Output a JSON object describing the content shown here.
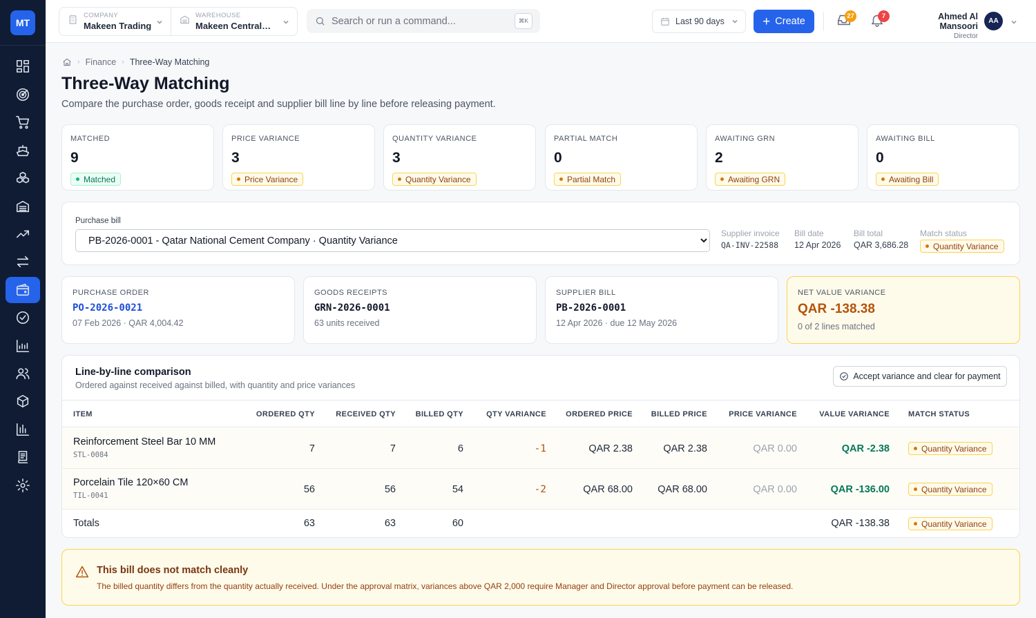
{
  "app": {
    "logo": "MT"
  },
  "sidebar": {
    "items": [
      {
        "icon": "dashboard-icon"
      },
      {
        "icon": "target-icon"
      },
      {
        "icon": "cart-icon"
      },
      {
        "icon": "ship-icon"
      },
      {
        "icon": "boxes-icon"
      },
      {
        "icon": "warehouse-icon"
      },
      {
        "icon": "trending-up-icon"
      },
      {
        "icon": "transfer-icon"
      },
      {
        "icon": "wallet-icon",
        "active": true
      },
      {
        "icon": "check-circle-icon"
      },
      {
        "icon": "chart-icon"
      },
      {
        "icon": "users-icon"
      },
      {
        "icon": "package-icon"
      },
      {
        "icon": "bar-chart-icon"
      },
      {
        "icon": "ledger-icon"
      },
      {
        "icon": "settings-icon"
      }
    ]
  },
  "topbar": {
    "company_label": "COMPANY",
    "company_value": "Makeen Trading",
    "warehouse_label": "WAREHOUSE",
    "warehouse_value": "Makeen Central Warehouse",
    "search_placeholder": "Search or run a command...",
    "search_kbd": "⌘K",
    "date_range": "Last 90 days",
    "create_label": "Create",
    "inbox_count": "27",
    "notif_count": "7",
    "user_name": "Ahmed Al Mansoori",
    "user_role": "Director",
    "user_initials": "AA",
    "colors": {
      "accent": "#2563eb",
      "inbox_badge": "#f59e0b",
      "notif_badge": "#ef4444"
    }
  },
  "breadcrumb": {
    "section": "Finance",
    "current": "Three-Way Matching"
  },
  "page": {
    "title": "Three-Way Matching",
    "subtitle": "Compare the purchase order, goods receipt and supplier bill line by line before releasing payment."
  },
  "stats": [
    {
      "label": "MATCHED",
      "value": "9",
      "pill": "Matched"
    },
    {
      "label": "PRICE VARIANCE",
      "value": "3",
      "pill": "Price Variance"
    },
    {
      "label": "QUANTITY VARIANCE",
      "value": "3",
      "pill": "Quantity Variance"
    },
    {
      "label": "PARTIAL MATCH",
      "value": "0",
      "pill": "Partial Match"
    },
    {
      "label": "AWAITING GRN",
      "value": "2",
      "pill": "Awaiting GRN"
    },
    {
      "label": "AWAITING BILL",
      "value": "0",
      "pill": "Awaiting Bill"
    }
  ],
  "bill": {
    "label": "Purchase bill",
    "selected": "PB-2026-0001 - Qatar National Cement Company · Quantity Variance",
    "supplier_invoice_label": "Supplier invoice",
    "supplier_invoice": "QA-INV-22588",
    "bill_date_label": "Bill date",
    "bill_date": "12 Apr 2026",
    "bill_total_label": "Bill total",
    "bill_total": "QAR 3,686.28",
    "match_status_label": "Match status",
    "match_status": "Quantity Variance"
  },
  "docs": {
    "po_label": "PURCHASE ORDER",
    "po_value": "PO-2026-0021",
    "po_sub": "07 Feb 2026 · QAR 4,004.42",
    "grn_label": "GOODS RECEIPTS",
    "grn_value": "GRN-2026-0001",
    "grn_sub": "63 units received",
    "sb_label": "SUPPLIER BILL",
    "sb_value": "PB-2026-0001",
    "sb_sub": "12 Apr 2026 · due 12 May 2026",
    "nv_label": "NET VALUE VARIANCE",
    "nv_value": "QAR -138.38",
    "nv_sub": "0 of 2 lines matched"
  },
  "table": {
    "title": "Line-by-line comparison",
    "subtitle": "Ordered against received against billed, with quantity and price variances",
    "accept_label": "Accept variance and clear for payment",
    "headers": {
      "item": "ITEM",
      "ordered_qty": "ORDERED QTY",
      "received_qty": "RECEIVED QTY",
      "billed_qty": "BILLED QTY",
      "qty_variance": "QTY VARIANCE",
      "ordered_price": "ORDERED PRICE",
      "billed_price": "BILLED PRICE",
      "price_variance": "PRICE VARIANCE",
      "value_variance": "VALUE VARIANCE",
      "match_status": "MATCH STATUS"
    },
    "rows": [
      {
        "name": "Reinforcement Steel Bar 10 MM",
        "sku": "STL-0084",
        "ordered_qty": "7",
        "received_qty": "7",
        "billed_qty": "6",
        "qty_variance": "-1",
        "ordered_price": "QAR 2.38",
        "billed_price": "QAR 2.38",
        "price_variance": "QAR 0.00",
        "value_variance": "QAR -2.38",
        "match_status": "Quantity Variance"
      },
      {
        "name": "Porcelain Tile 120×60 CM",
        "sku": "TIL-0041",
        "ordered_qty": "56",
        "received_qty": "56",
        "billed_qty": "54",
        "qty_variance": "-2",
        "ordered_price": "QAR 68.00",
        "billed_price": "QAR 68.00",
        "price_variance": "QAR 0.00",
        "value_variance": "QAR -136.00",
        "match_status": "Quantity Variance"
      }
    ],
    "totals": {
      "label": "Totals",
      "ordered_qty": "63",
      "received_qty": "63",
      "billed_qty": "60",
      "value_variance": "QAR -138.38",
      "match_status": "Quantity Variance"
    }
  },
  "alert": {
    "title": "This bill does not match cleanly",
    "body": "The billed quantity differs from the quantity actually received. Under the approval matrix, variances above QAR 2,000 require Manager and Director approval before payment can be released."
  }
}
